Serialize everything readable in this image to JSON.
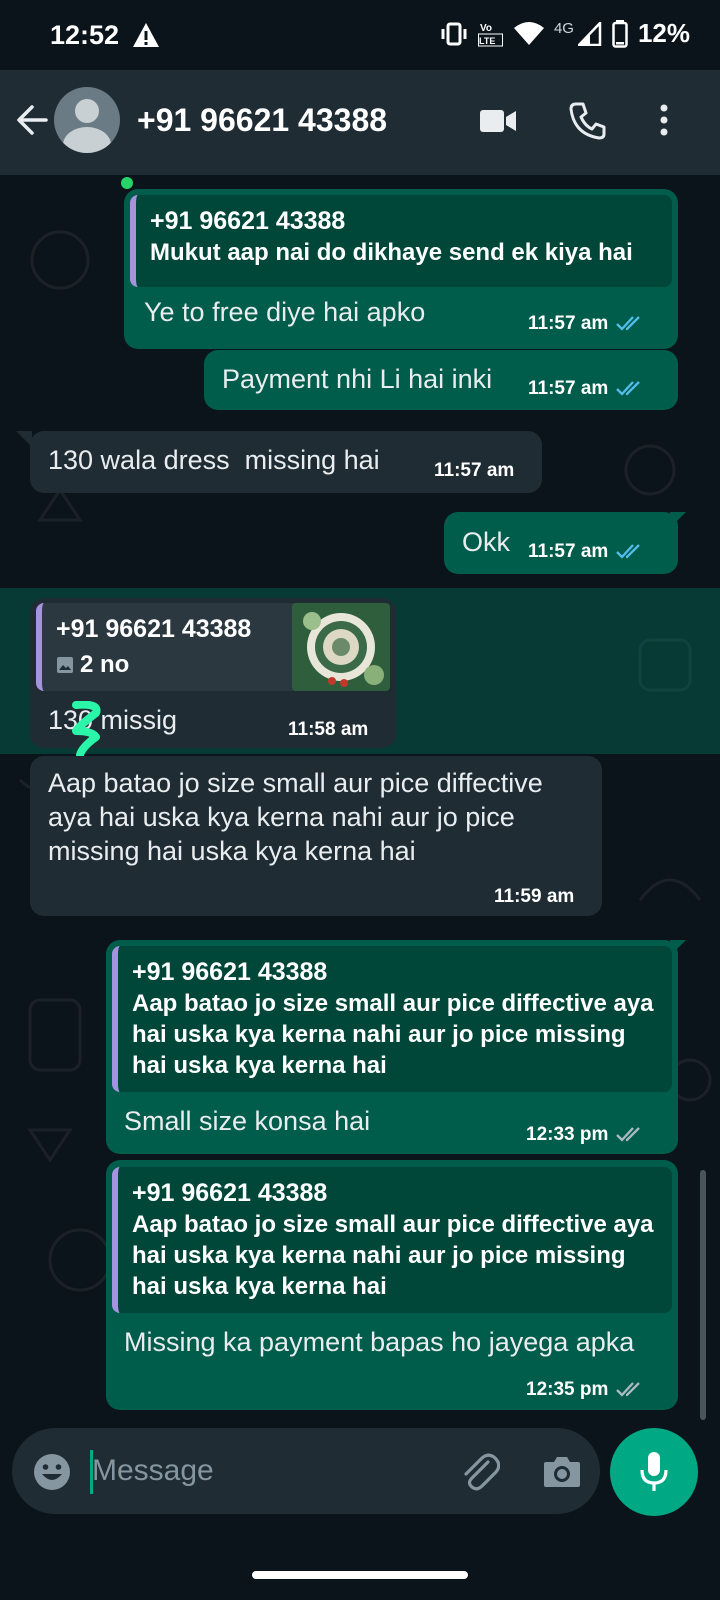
{
  "status_bar": {
    "time": "12:52",
    "battery": "12%",
    "network": "4G",
    "volte": "Vo LTE",
    "icons": [
      "warning-icon",
      "vibrate-icon",
      "volte-icon",
      "wifi-icon",
      "signal-icon",
      "battery-icon"
    ]
  },
  "header": {
    "contact_name": "+91 96621 43388",
    "icons": [
      "back-arrow-icon",
      "avatar-icon",
      "video-call-icon",
      "voice-call-icon",
      "more-vert-icon"
    ]
  },
  "colors": {
    "background": "#0b141a",
    "header": "#1f2c34",
    "outgoing_bubble": "#005c4b",
    "incoming_bubble": "#1f2c34",
    "accent": "#00a884",
    "read_tick": "#53bdeb",
    "quote_bar": "#a593e0"
  },
  "messages": [
    {
      "direction": "out",
      "quote": {
        "name": "+91 96621 43388",
        "text": "Mukut aap nai do dikhaye send ek kiya hai"
      },
      "text": "Ye to free diye hai apko",
      "time": "11:57 am",
      "status": "read"
    },
    {
      "direction": "out",
      "text": "Payment nhi Li hai inki",
      "time": "11:57 am",
      "status": "read"
    },
    {
      "direction": "in",
      "text": "130 wala dress  missing hai",
      "time": "11:57 am"
    },
    {
      "direction": "out",
      "text": "Okk",
      "time": "11:57 am",
      "status": "read"
    },
    {
      "direction": "in",
      "highlighted": true,
      "quote": {
        "name": "+91 96621 43388",
        "text": "2 no",
        "has_image": true
      },
      "text": "130 missig",
      "time": "11:58 am"
    },
    {
      "direction": "in",
      "text": "Aap batao jo size small aur pice diffective aya hai uska kya kerna nahi aur jo pice missing hai uska kya kerna hai",
      "time": "11:59 am"
    },
    {
      "direction": "out",
      "quote": {
        "name": "+91 96621 43388",
        "text": "Aap batao jo size small aur pice diffective aya hai uska kya kerna nahi aur jo pice missing hai uska kya kerna hai"
      },
      "text": "Small size konsa hai",
      "time": "12:33 pm",
      "status": "delivered"
    },
    {
      "direction": "out",
      "quote": {
        "name": "+91 96621 43388",
        "text": "Aap batao jo size small aur pice diffective aya hai uska kya kerna nahi aur jo pice missing hai uska kya kerna hai"
      },
      "text": "Missing ka payment bapas ho jayega apka",
      "time": "12:35 pm",
      "status": "delivered"
    }
  ],
  "composer": {
    "placeholder": "Message",
    "icons": [
      "emoji-icon",
      "attach-icon",
      "camera-icon",
      "mic-icon"
    ]
  }
}
